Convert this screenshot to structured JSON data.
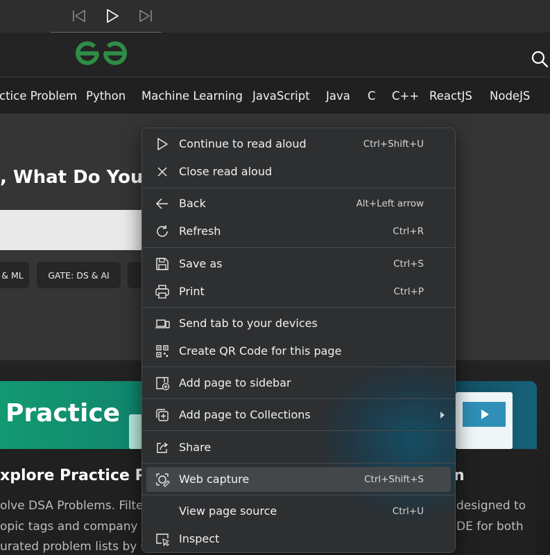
{
  "page": {
    "nav_items": [
      "ctice Problem",
      "Python",
      "Machine Learning",
      "JavaScript",
      "Java",
      "C",
      "C++",
      "ReactJS",
      "NodeJS"
    ],
    "hero_title": ", What Do You W",
    "chips": [
      "& ML",
      "GATE: DS & AI"
    ],
    "banner_title": "Practice",
    "card_title": "xplore Practice Pro",
    "card_title_right": "n",
    "card_lines_left": [
      "olve DSA Problems. Filte",
      "opic tags and company ta",
      "urated problem lists by G"
    ],
    "card_lines_right": [
      "designed to",
      "DE for both"
    ]
  },
  "context_menu": {
    "groups": [
      [
        {
          "label": "Continue to read aloud",
          "shortcut": "Ctrl+Shift+U",
          "icon": "play-icon"
        },
        {
          "label": "Close read aloud",
          "shortcut": "",
          "icon": "close-icon"
        }
      ],
      [
        {
          "label": "Back",
          "shortcut": "Alt+Left arrow",
          "icon": "back-arrow-icon"
        },
        {
          "label": "Refresh",
          "shortcut": "Ctrl+R",
          "icon": "refresh-icon"
        }
      ],
      [
        {
          "label": "Save as",
          "shortcut": "Ctrl+S",
          "icon": "save-icon"
        },
        {
          "label": "Print",
          "shortcut": "Ctrl+P",
          "icon": "print-icon"
        }
      ],
      [
        {
          "label": "Send tab to your devices",
          "shortcut": "",
          "icon": "devices-icon"
        },
        {
          "label": "Create QR Code for this page",
          "shortcut": "",
          "icon": "qr-code-icon"
        }
      ],
      [
        {
          "label": "Add page to sidebar",
          "shortcut": "",
          "icon": "sidebar-add-icon"
        }
      ],
      [
        {
          "label": "Add page to Collections",
          "shortcut": "",
          "icon": "collections-icon",
          "submenu": true
        }
      ],
      [
        {
          "label": "Share",
          "shortcut": "",
          "icon": "share-icon"
        }
      ],
      [
        {
          "label": "Web capture",
          "shortcut": "Ctrl+Shift+S",
          "icon": "web-capture-icon",
          "highlighted": true
        }
      ],
      [
        {
          "label": "View page source",
          "shortcut": "Ctrl+U",
          "icon": ""
        },
        {
          "label": "Inspect",
          "shortcut": "",
          "icon": "inspect-icon"
        }
      ]
    ]
  },
  "colors": {
    "menu_bg": "#2d2f31",
    "menu_hover": "#44474a",
    "logo_green": "#2f8d46",
    "separator": "#4a4a4a"
  }
}
